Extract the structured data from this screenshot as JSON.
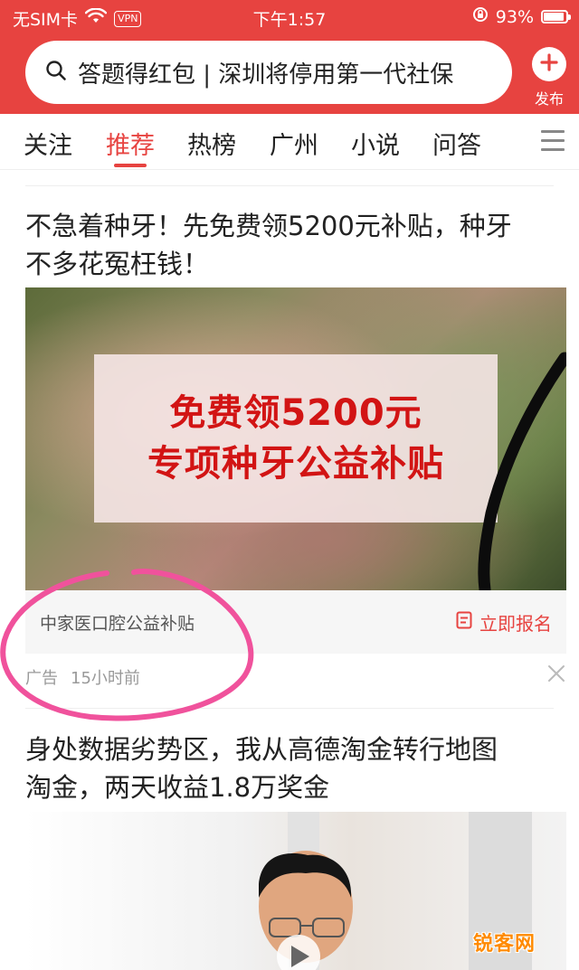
{
  "status_bar": {
    "carrier": "无SIM卡",
    "vpn": "VPN",
    "time": "下午1:57",
    "battery": "93%"
  },
  "header": {
    "search_text": "答题得红包 | 深圳将停用第一代社保",
    "publish_label": "发布"
  },
  "tabs": [
    "关注",
    "推荐",
    "热榜",
    "广州",
    "小说",
    "问答"
  ],
  "active_tab": "推荐",
  "feed": {
    "ad": {
      "title_line1": "不急着种牙！先免费领5200元补贴，种牙",
      "title_line2": "不多花冤枉钱！",
      "banner_line1": "免费领5200元",
      "banner_line2": "专项种牙公益补贴",
      "advertiser": "中家医口腔公益补贴",
      "cta_label": "立即报名",
      "ad_label": "广告",
      "time_ago": "15小时前"
    },
    "article2": {
      "title_line1": "身处数据劣势区，我从高德淘金转行地图",
      "title_line2": "淘金，两天收益1.8万奖金"
    }
  },
  "watermark": "锐客网",
  "colors": {
    "brand_red": "#e74340",
    "banner_text": "#d21414",
    "annotation_pink": "#f0529c"
  }
}
